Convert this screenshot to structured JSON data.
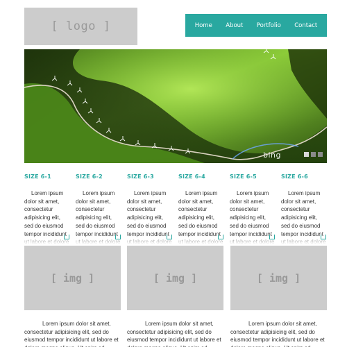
{
  "logo": {
    "text": "[ logo ]"
  },
  "nav": {
    "items": [
      "Home",
      "About",
      "Portfolio",
      "Contact"
    ],
    "color": "#29a8a0"
  },
  "slider": {
    "watermark": "bing",
    "slide_count": 3,
    "active_slide": 1
  },
  "columns": [
    {
      "heading": "SIZE 6-1",
      "text": "Lorem ipsum dolor sit amet, consectetur adipisicing elit, sed do eiusmod tempor incididunt ut labore et dolore magna aliqua."
    },
    {
      "heading": "SIZE 6-2",
      "text": "Lorem ipsum dolor sit amet, consectetur adipisicing elit, sed do eiusmod tempor incididunt ut labore et dolore magna aliqua."
    },
    {
      "heading": "SIZE 6-3",
      "text": "Lorem ipsum dolor sit amet, consectetur adipisicing elit, sed do eiusmod tempor incididunt ut labore et dolore magna aliqua."
    },
    {
      "heading": "SIZE 6-4",
      "text": "Lorem ipsum dolor sit amet, consectetur adipisicing elit, sed do eiusmod tempor incididunt ut labore et dolore magna aliqua."
    },
    {
      "heading": "SIZE 6-5",
      "text": "Lorem ipsum dolor sit amet, consectetur adipisicing elit, sed do eiusmod tempor incididunt ut labore et dolore magna aliqua."
    },
    {
      "heading": "SIZE 6-6",
      "text": "Lorem ipsum dolor sit amet, consectetur adipisicing elit, sed do eiusmod tempor incididunt ut labore et dolore magna aliqua."
    }
  ],
  "images": [
    {
      "text": "[ img ]",
      "caption": "Lorem ipsum dolor sit amet, consectetur adipisicing elit, sed do eiusmod tempor incididunt ut labore et dolore magna aliqua. Ut enim ad minim veniam."
    },
    {
      "text": "[ img ]",
      "caption": "Lorem ipsum dolor sit amet, consectetur adipisicing elit, sed do eiusmod tempor incididunt ut labore et dolore magna aliqua. Ut enim ad minim veniam."
    },
    {
      "text": "[ img ]",
      "caption": "Lorem ipsum dolor sit amet, consectetur adipisicing elit, sed do eiusmod tempor incididunt ut labore et dolore magna aliqua. Ut enim ad minim veniam."
    }
  ]
}
